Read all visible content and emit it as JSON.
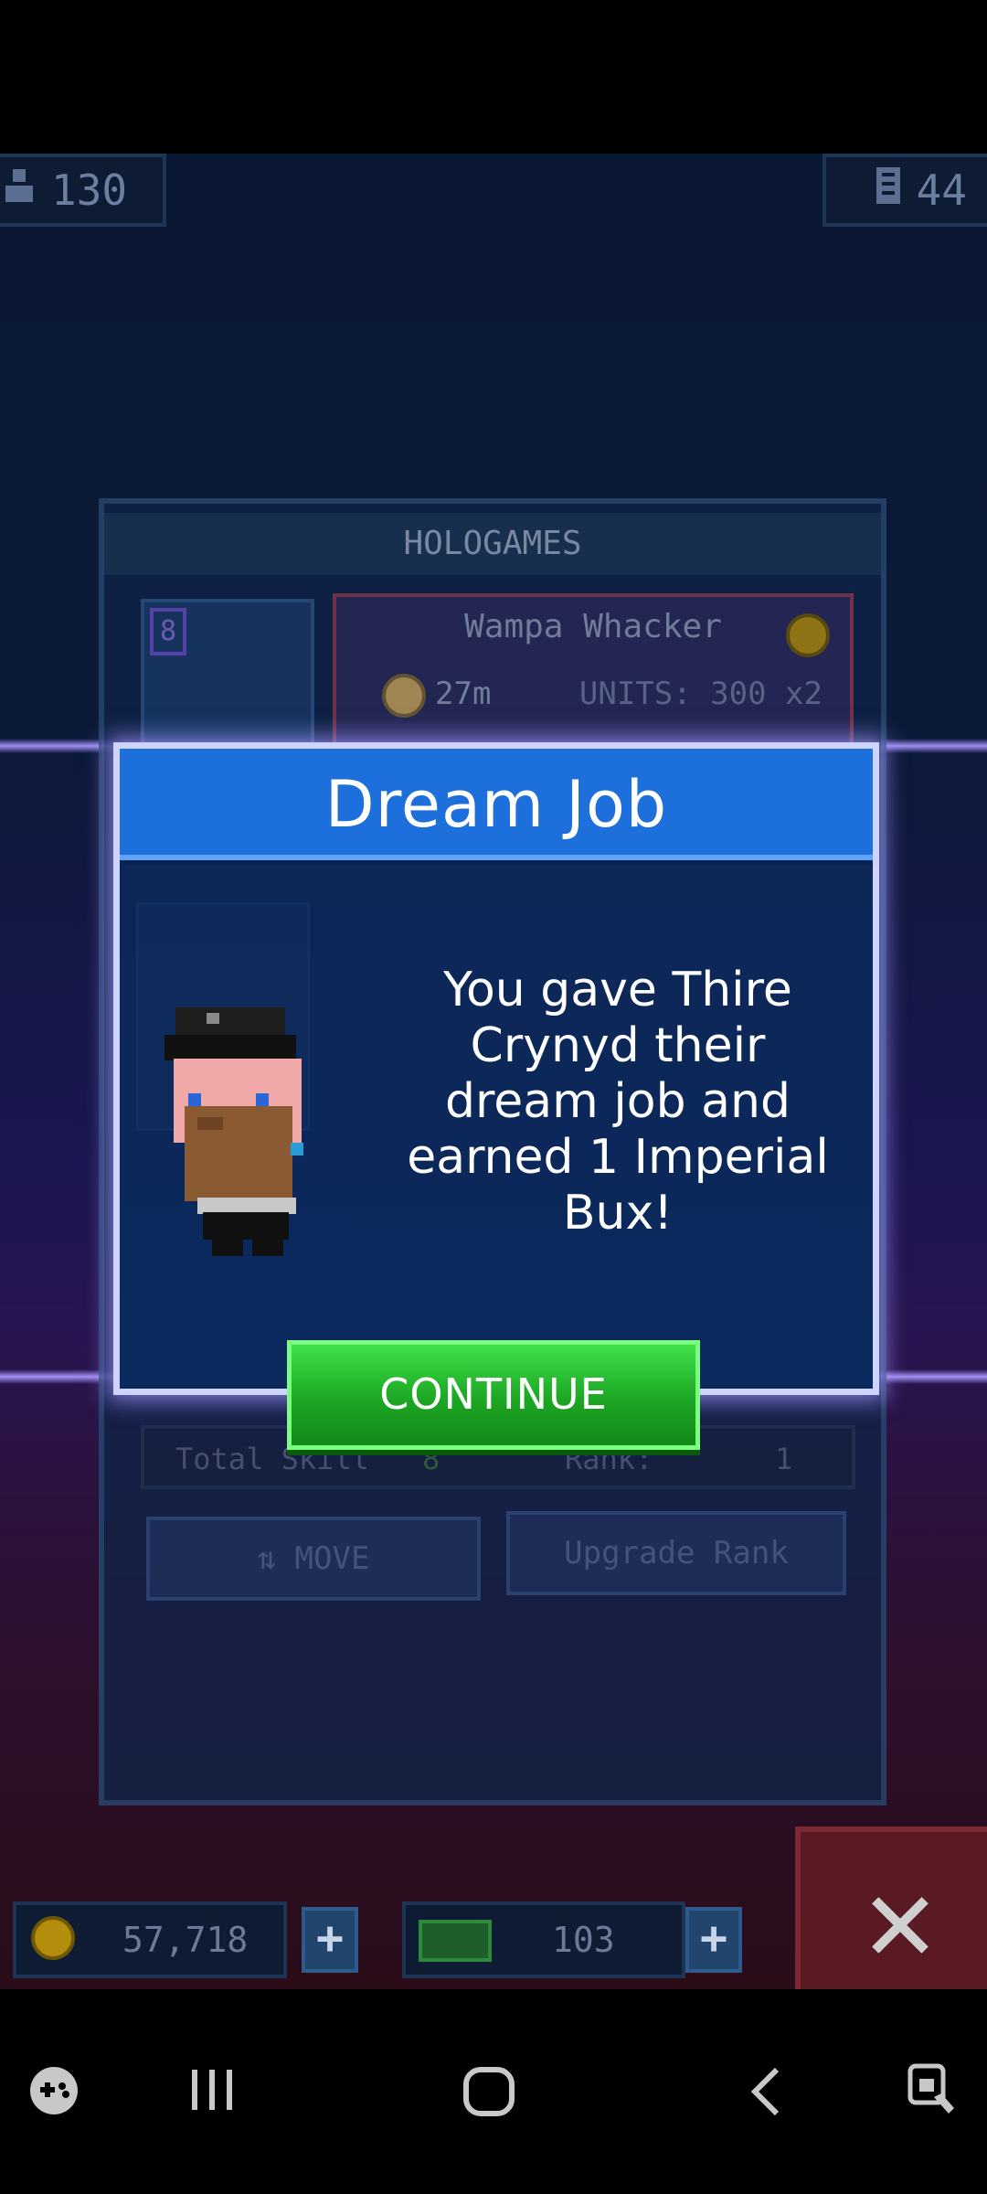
{
  "hud": {
    "population": "130",
    "floors": "44",
    "population_icon": "person-icon",
    "floors_icon": "building-icon"
  },
  "floor_panel": {
    "title": "HOLOGAMES",
    "employee_level": "8",
    "job_name": "Wampa Whacker",
    "job_time": "27m",
    "job_units": "UNITS: 300 x2",
    "total_skill_label": "Total Skill",
    "total_skill_value": "8",
    "rank_label": "Rank:",
    "rank_value": "1",
    "move_label": "MOVE",
    "upgrade_label": "Upgrade Rank"
  },
  "dialog": {
    "title": "Dream Job",
    "message": "You gave Thire Crynyd their dream job and earned 1 Imperial Bux!",
    "continue_label": "CONTINUE"
  },
  "resources": {
    "coins": "57,718",
    "bux": "103"
  },
  "colors": {
    "dialog_header": "#1d6fdb",
    "continue_green": "#1ca623",
    "dialog_border": "#cfd4ff"
  },
  "nav": {
    "items": [
      "game-launcher-icon",
      "recent-apps-icon",
      "home-icon",
      "back-icon",
      "accessibility-icon"
    ]
  }
}
